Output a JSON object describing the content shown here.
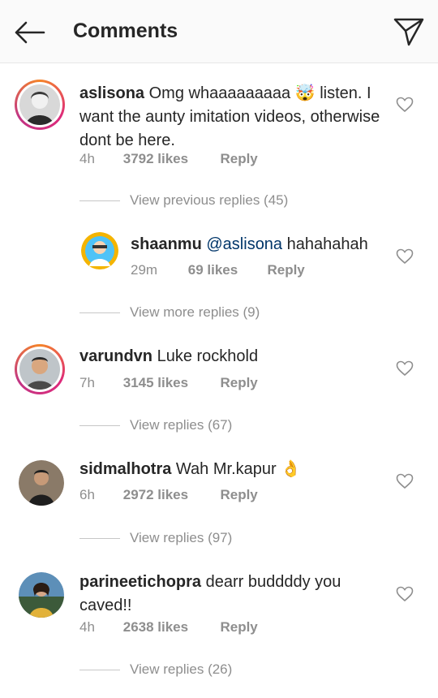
{
  "header": {
    "title": "Comments"
  },
  "comments": [
    {
      "username": "aslisona",
      "text": "Omg whaaaaaaaaa 🤯 listen. I want the aunty imitation videos, otherwise dont be here.",
      "time": "4h",
      "likes": "3792 likes",
      "reply": "Reply",
      "replies_toggle": "View previous replies (45)"
    },
    {
      "username": "shaanmu",
      "mention": "@aslisona",
      "text": "hahahahah",
      "time": "29m",
      "likes": "69 likes",
      "reply": "Reply",
      "replies_toggle": "View more replies (9)"
    },
    {
      "username": "varundvn",
      "text": "Luke rockhold",
      "time": "7h",
      "likes": "3145 likes",
      "reply": "Reply",
      "replies_toggle": "View replies (67)"
    },
    {
      "username": "sidmalhotra",
      "text": "Wah Mr.kapur 👌",
      "time": "6h",
      "likes": "2972 likes",
      "reply": "Reply",
      "replies_toggle": "View replies (97)"
    },
    {
      "username": "parineetichopra",
      "text": "dearr buddddy you caved!!",
      "time": "4h",
      "likes": "2638 likes",
      "reply": "Reply",
      "replies_toggle": "View replies (26)"
    }
  ],
  "icons": {
    "back": "arrow-left-icon",
    "send": "paper-plane-icon",
    "like": "heart-outline-icon"
  },
  "colors": {
    "ring_start": "#f58529",
    "ring_end": "#dd2a7b",
    "mention": "#003569",
    "muted": "#8e8e8e"
  }
}
